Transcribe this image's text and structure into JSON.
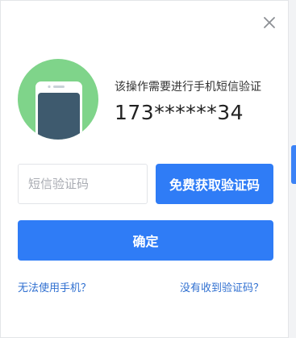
{
  "dialog": {
    "close_icon": "close-icon",
    "hint": "该操作需要进行手机短信验证",
    "phone_number": "173******34",
    "code_input_placeholder": "短信验证码",
    "code_input_value": "",
    "get_code_label": "免费获取验证码",
    "confirm_label": "确定",
    "link_cannot_use_phone": "无法使用手机？",
    "link_no_code": "没有收到验证码？"
  },
  "colors": {
    "primary": "#2f7cf6",
    "avatar_bg": "#7fd48a",
    "phone_body": "#3e5a6e",
    "link": "#2f6fd0"
  }
}
